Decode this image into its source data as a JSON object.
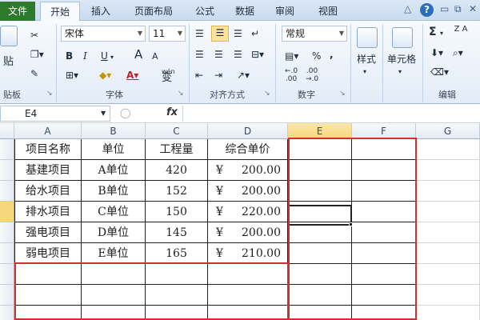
{
  "tabs": {
    "file": "文件",
    "items": [
      "开始",
      "插入",
      "页面布局",
      "公式",
      "数据",
      "审阅",
      "视图"
    ],
    "active": "开始",
    "help": "?"
  },
  "ribbon": {
    "clipboard": {
      "label": "贴板",
      "paste": "贴",
      "cut_icon": "scissors-icon",
      "copy_icon": "copy-icon",
      "format_painter_icon": "brush-icon"
    },
    "font": {
      "label": "字体",
      "font_name": "宋体",
      "font_size": "11",
      "bold": "B",
      "italic": "I",
      "underline": "U",
      "grow": "A",
      "shrink": "A",
      "wen": "wén",
      "change": "变"
    },
    "alignment": {
      "label": "对齐方式"
    },
    "number": {
      "label": "数字",
      "format": "常规",
      "percent": "%",
      "comma": ",",
      "dec_inc": "←.0\n.00",
      "dec_dec": ".00\n→.0"
    },
    "styles": {
      "label": "样式"
    },
    "cells": {
      "label": "单元格"
    },
    "editing": {
      "label": "编辑",
      "sum": "Σ",
      "sort": "Z A"
    }
  },
  "formula_bar": {
    "name_box": "E4",
    "fx": "fx",
    "formula": ""
  },
  "columns": [
    "A",
    "B",
    "C",
    "D",
    "E",
    "F",
    "G"
  ],
  "selected_column": "E",
  "table": {
    "headers": [
      "项目名称",
      "单位",
      "工程量",
      "综合单价"
    ],
    "currency": "¥",
    "rows": [
      {
        "name": "基建项目",
        "unit": "A单位",
        "qty": "420",
        "price": "200.00"
      },
      {
        "name": "给水项目",
        "unit": "B单位",
        "qty": "152",
        "price": "200.00"
      },
      {
        "name": "排水项目",
        "unit": "C单位",
        "qty": "150",
        "price": "220.00"
      },
      {
        "name": "强电项目",
        "unit": "D单位",
        "qty": "145",
        "price": "200.00"
      },
      {
        "name": "弱电项目",
        "unit": "E单位",
        "qty": "165",
        "price": "210.00"
      }
    ]
  },
  "colors": {
    "file_tab": "#2d7a2d",
    "highlight": "#d0302f",
    "selected_header": "#f6d77d"
  }
}
